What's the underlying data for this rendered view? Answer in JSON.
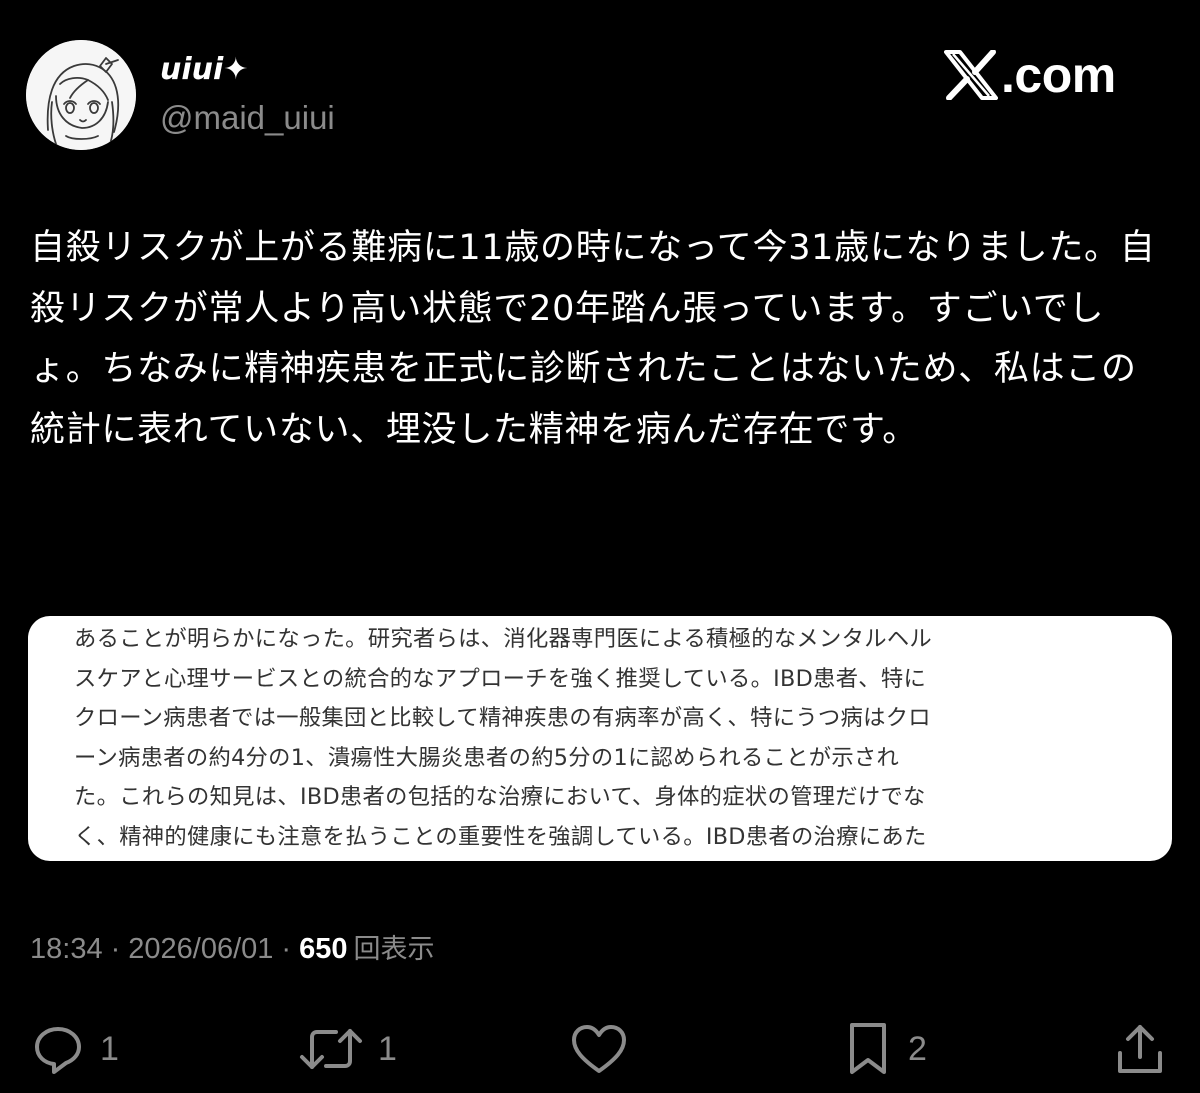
{
  "author": {
    "display_name": "uiui✦",
    "handle": "@maid_uiui",
    "avatar_icon": "avatar-drawing-icon"
  },
  "site": {
    "logo_text": ".com",
    "logo_icon": "x-logo-icon"
  },
  "tweet": {
    "text": "自殺リスクが上がる難病に11歳の時になって今31歳になりました。自殺リスクが常人より高い状態で20年踏ん張っています。すごいでしょ。ちなみに精神疾患を正式に診断されたことはないため、私はこの統計に表れていない、埋没した精神を病んだ存在です。"
  },
  "attached_image": {
    "lines": [
      "あることが明らかになった。研究者らは、消化器専門医による積極的なメンタルヘル",
      "スケアと心理サービスとの統合的なアプローチを強く推奨している。IBD患者、特に",
      "クローン病患者では一般集団と比較して精神疾患の有病率が高く、特にうつ病はクロ",
      "ーン病患者の約4分の1、潰瘍性大腸炎患者の約5分の1に認められることが示され",
      "た。これらの知見は、IBD患者の包括的な治療において、身体的症状の管理だけでな",
      "く、精神的健康にも注意を払うことの重要性を強調している。IBD患者の治療にあた"
    ]
  },
  "meta": {
    "time": "18:34",
    "separator": "·",
    "date": "2026/06/01",
    "views_count": "650",
    "views_label": "回表示"
  },
  "actions": {
    "reply": {
      "icon": "reply-icon",
      "count": "1"
    },
    "repost": {
      "icon": "repost-icon",
      "count": "1"
    },
    "like": {
      "icon": "heart-icon",
      "count": ""
    },
    "bookmark": {
      "icon": "bookmark-icon",
      "count": "2"
    },
    "share": {
      "icon": "share-icon",
      "count": ""
    }
  },
  "colors": {
    "background": "#000000",
    "text_primary": "#ffffff",
    "text_secondary": "#8b8b8b",
    "card_background": "#ffffff",
    "card_text": "#333333"
  }
}
